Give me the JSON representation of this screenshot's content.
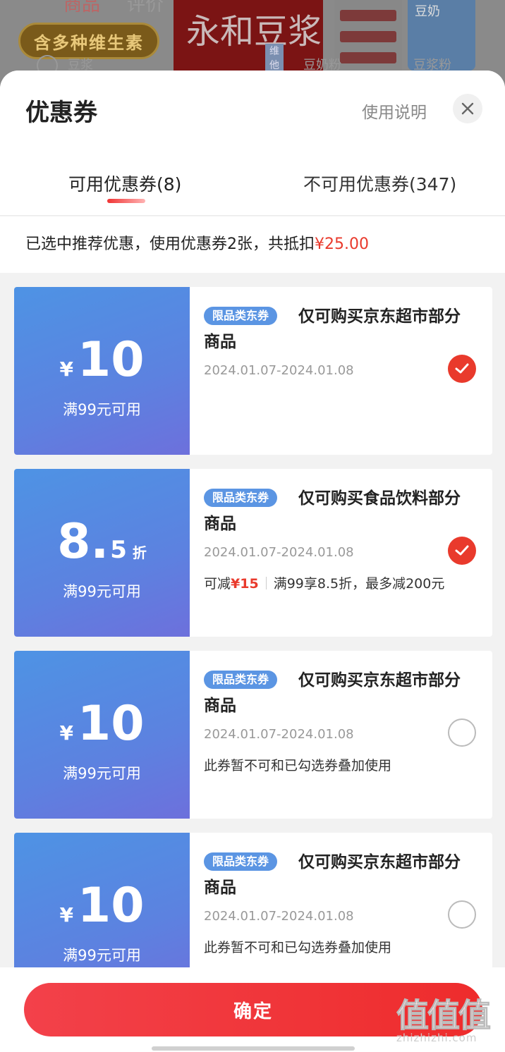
{
  "background": {
    "tabs": [
      "商品",
      "评价"
    ],
    "pill_label": "含多种维生素",
    "product_title": "永和豆浆",
    "product_tag": "维他",
    "captions": [
      "豆浆",
      "豆奶粉",
      "豆浆粉"
    ],
    "milk_mark": "豆奶"
  },
  "sheet": {
    "title": "优惠券",
    "help_label": "使用说明",
    "close_icon": "close-icon",
    "tabs": [
      {
        "label": "可用优惠券(8)",
        "active": true
      },
      {
        "label": "不可用优惠券(347)",
        "active": false
      }
    ],
    "summary_prefix": "已选中推荐优惠，使用优惠券2张，共抵扣",
    "summary_amount": "¥25.00"
  },
  "coupons": [
    {
      "currency": "¥",
      "amount": "10",
      "condition": "满99元可用",
      "badge": "限品类东券",
      "title": "仅可购买京东超市部分商品",
      "date": "2024.01.07-2024.01.08",
      "note": "",
      "checked": true
    },
    {
      "amount_main": "8.",
      "amount_small": "5",
      "unit": "折",
      "condition": "满99元可用",
      "badge": "限品类东券",
      "title": "仅可购买食品饮料部分商品",
      "date": "2024.01.07-2024.01.08",
      "note_prefix": "可减",
      "note_amount": "¥15",
      "note_rule": "满99享8.5折，最多减200元",
      "checked": true
    },
    {
      "currency": "¥",
      "amount": "10",
      "condition": "满99元可用",
      "badge": "限品类东券",
      "title": "仅可购买京东超市部分商品",
      "date": "2024.01.07-2024.01.08",
      "note": "此券暂不可和已勾选券叠加使用",
      "checked": false
    },
    {
      "currency": "¥",
      "amount": "10",
      "condition": "满99元可用",
      "badge": "限品类东券",
      "title": "仅可购买京东超市部分商品",
      "date": "2024.01.07-2024.01.08",
      "note": "此券暂不可和已勾选券叠加使用",
      "checked": false
    }
  ],
  "footer": {
    "confirm_label": "确定"
  },
  "watermark": {
    "logo": "值值值",
    "domain": "zhizhizhi.com"
  },
  "colors": {
    "accent_red": "#e93a2c",
    "coupon_blue": "#5b95e3"
  }
}
